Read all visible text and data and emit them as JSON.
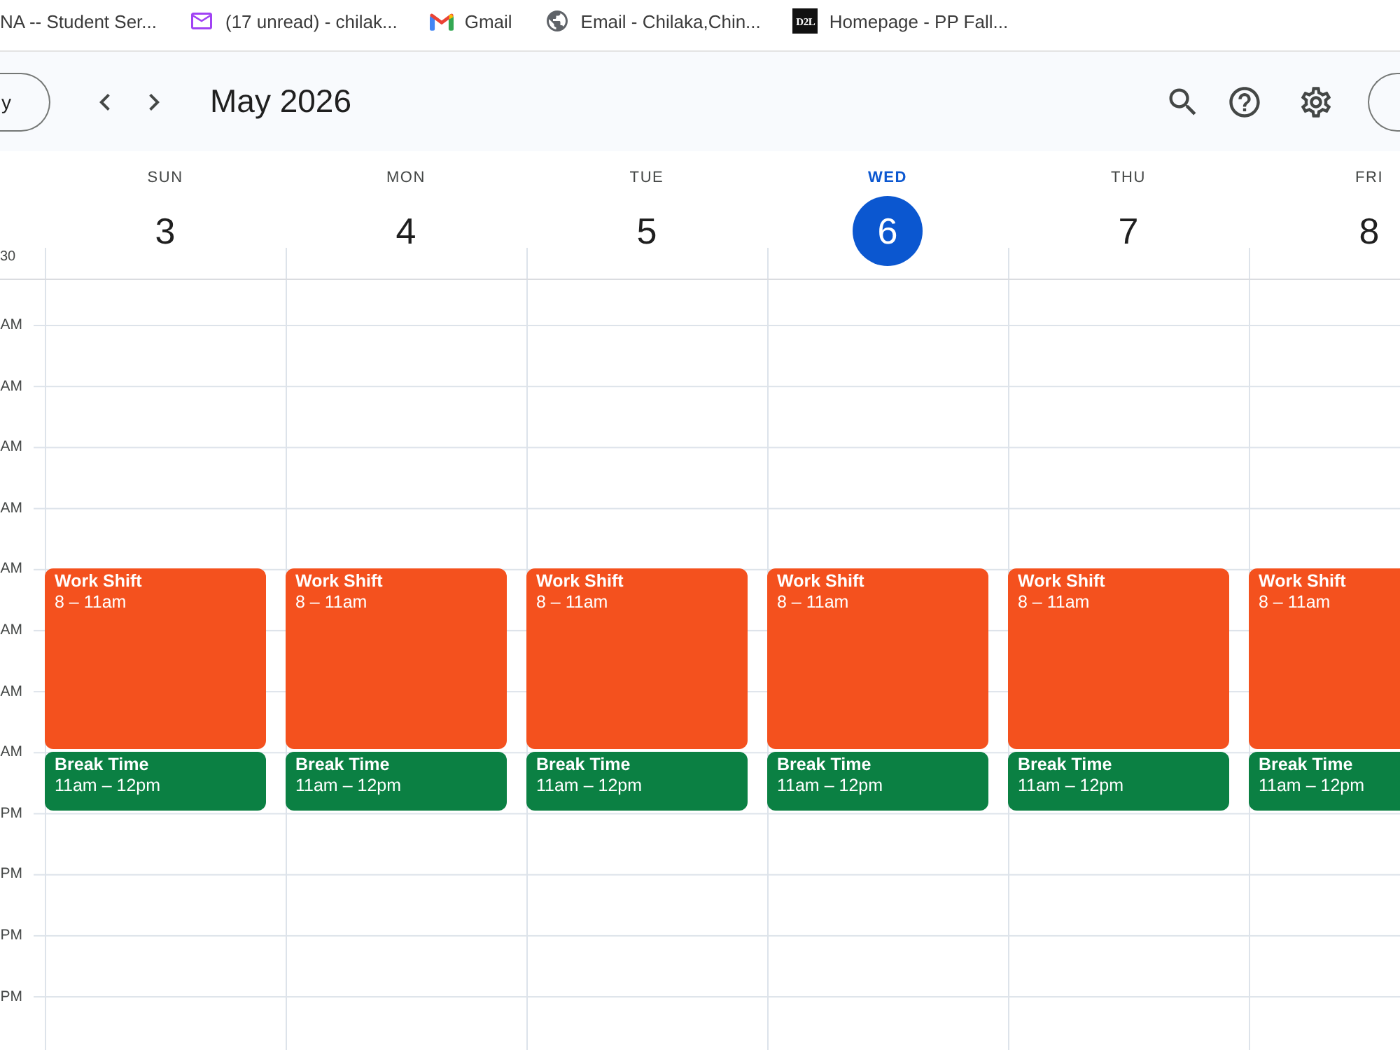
{
  "bookmarks": [
    {
      "kind": "plain",
      "label": "NA -- Student Ser..."
    },
    {
      "kind": "mail",
      "label": "(17 unread) - chilak..."
    },
    {
      "kind": "gmail",
      "label": "Gmail"
    },
    {
      "kind": "globe",
      "label": "Email - Chilaka,Chin..."
    },
    {
      "kind": "d2l",
      "logo_text": "D2L",
      "label": "Homepage - PP Fall..."
    }
  ],
  "toolbar": {
    "today_button": "y",
    "title": "May 2026"
  },
  "calendar": {
    "timezone": "30",
    "hour_labels": [
      "AM",
      "AM",
      "AM",
      "AM",
      "AM",
      "AM",
      "AM",
      "AM",
      "PM",
      "PM",
      "PM",
      "PM"
    ],
    "days": [
      {
        "name": "SUN",
        "number": "3",
        "today": false,
        "events": [
          {
            "kind": "shift",
            "title": "Work Shift",
            "time": "8 – 11am",
            "color": "#f4511e"
          },
          {
            "kind": "break",
            "title": "Break Time",
            "time": "11am – 12pm",
            "color": "#0b8043"
          }
        ]
      },
      {
        "name": "MON",
        "number": "4",
        "today": false,
        "events": [
          {
            "kind": "shift",
            "title": "Work Shift",
            "time": "8 – 11am",
            "color": "#f4511e"
          },
          {
            "kind": "break",
            "title": "Break Time",
            "time": "11am – 12pm",
            "color": "#0b8043"
          }
        ]
      },
      {
        "name": "TUE",
        "number": "5",
        "today": false,
        "events": [
          {
            "kind": "shift",
            "title": "Work Shift",
            "time": "8 – 11am",
            "color": "#f4511e"
          },
          {
            "kind": "break",
            "title": "Break Time",
            "time": "11am – 12pm",
            "color": "#0b8043"
          }
        ]
      },
      {
        "name": "WED",
        "number": "6",
        "today": true,
        "events": [
          {
            "kind": "shift",
            "title": "Work Shift",
            "time": "8 – 11am",
            "color": "#f4511e"
          },
          {
            "kind": "break",
            "title": "Break Time",
            "time": "11am – 12pm",
            "color": "#0b8043"
          }
        ]
      },
      {
        "name": "THU",
        "number": "7",
        "today": false,
        "events": [
          {
            "kind": "shift",
            "title": "Work Shift",
            "time": "8 – 11am",
            "color": "#f4511e"
          },
          {
            "kind": "break",
            "title": "Break Time",
            "time": "11am – 12pm",
            "color": "#0b8043"
          }
        ]
      },
      {
        "name": "FRI",
        "number": "8",
        "today": false,
        "events": [
          {
            "kind": "shift",
            "title": "Work Shift",
            "time": "8 – 11am",
            "color": "#f4511e"
          },
          {
            "kind": "break",
            "title": "Break Time",
            "time": "11am – 12pm",
            "color": "#0b8043"
          }
        ]
      }
    ]
  }
}
